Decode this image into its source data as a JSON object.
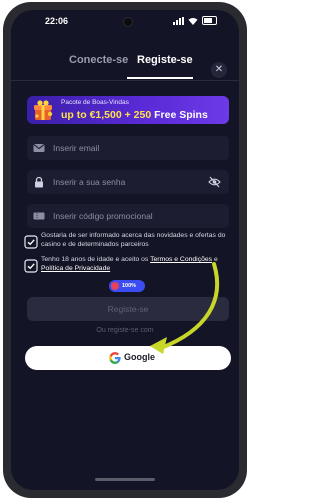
{
  "status_bar": {
    "time": "22:06"
  },
  "tabs": {
    "login": "Conecte-se",
    "register": "Registe-se"
  },
  "promo": {
    "line1": "Pacote de Boas-Vindas",
    "line2_prefix": "up to €1,500 + 250",
    "line2_suffix": "Free Spins"
  },
  "form": {
    "email_placeholder": "Inserir email",
    "password_placeholder": "Inserir a sua senha",
    "promo_code_placeholder": "Inserir código promocional"
  },
  "consents": {
    "marketing": "Gostaria de ser informado acerca das novidades e ofertas do casino e de determinados parceiros",
    "terms_prefix": "Tenho 18 anos de idade e aceito os",
    "terms_link": "Termos e Condições",
    "terms_and": "e",
    "privacy_link": "Política de Privacidade",
    "marketing_checked": true,
    "terms_checked": true
  },
  "badge": {
    "percent": "100%"
  },
  "buttons": {
    "register": "Registe-se",
    "or_register_with": "Ou registe-se com",
    "google": "Google"
  },
  "colors": {
    "background": "#131425",
    "promo_start": "#3a1fa8",
    "promo_end": "#6d3ae6",
    "promo_amount": "#ffe14a",
    "arrow": "#c8d62a",
    "checkbox_border": "#e8e9f5"
  },
  "icons": [
    "mail-icon",
    "lock-icon",
    "eye-off-icon",
    "coupon-icon",
    "checkbox-checked-icon",
    "google-logo-icon",
    "gift-icon",
    "close-icon"
  ]
}
